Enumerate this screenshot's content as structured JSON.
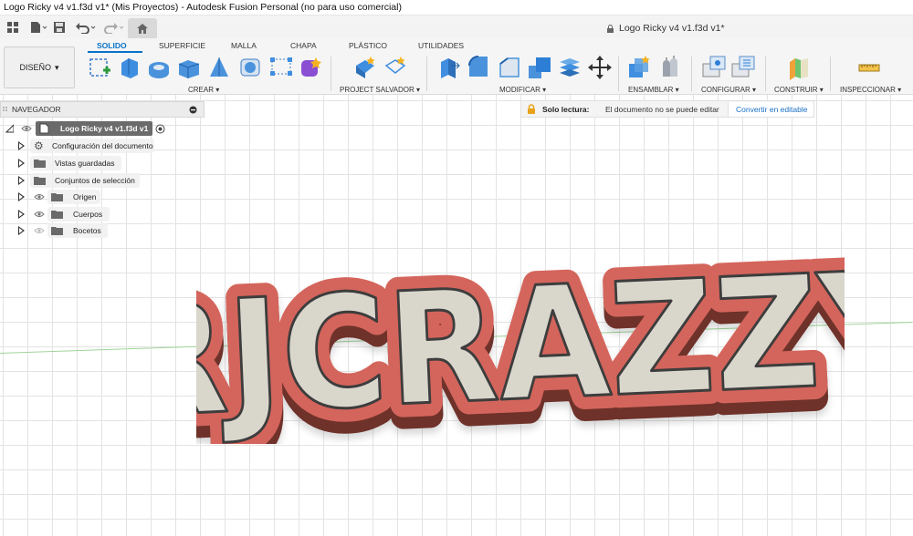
{
  "window": {
    "title": "Logo Ricky v4 v1.f3d v1* (Mis Proyectos) - Autodesk Fusion Personal (no para uso comercial)"
  },
  "document_tab": {
    "label": "Logo Ricky v4 v1.f3d v1*"
  },
  "workspace": {
    "label": "DISEÑO"
  },
  "ribbon": {
    "tabs": [
      "SOLIDO",
      "SUPERFICIE",
      "MALLA",
      "CHAPA",
      "PLÁSTICO",
      "UTILIDADES"
    ],
    "active_tab": "SOLIDO",
    "groups": [
      "CREAR",
      "PROJECT SALVADOR",
      "MODIFICAR",
      "ENSAMBLAR",
      "CONFIGURAR",
      "CONSTRUIR",
      "INSPECCIONAR"
    ]
  },
  "navigator": {
    "header": "NAVEGADOR",
    "root": "Logo Ricky v4 v1.f3d v1",
    "items": [
      {
        "label": "Configuración del documento",
        "icon": "gear-icon"
      },
      {
        "label": "Vistas guardadas",
        "icon": "folder-icon"
      },
      {
        "label": "Conjuntos de selección",
        "icon": "folder-icon"
      },
      {
        "label": "Origen",
        "icon": "folder-icon",
        "visibility": "eye-icon"
      },
      {
        "label": "Cuerpos",
        "icon": "folder-icon",
        "visibility": "eye-icon"
      },
      {
        "label": "Bocetos",
        "icon": "folder-icon",
        "visibility": "eye-hidden-icon"
      }
    ]
  },
  "readonly_banner": {
    "title": "Solo lectura:",
    "message": "El documento no se puede editar",
    "action": "Convertir en editable"
  },
  "model": {
    "text": "RJCRAZZY",
    "colors": {
      "outline": "#d4655b",
      "face": "#d9d6cc",
      "dark": "#8a3d36"
    }
  }
}
